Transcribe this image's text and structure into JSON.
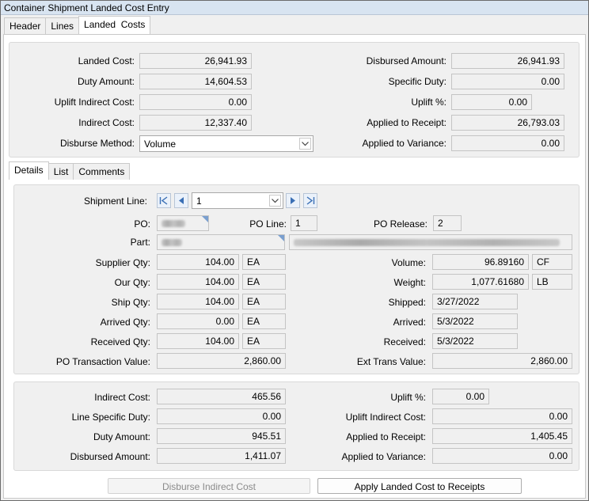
{
  "window": {
    "title": "Container Shipment Landed Cost Entry"
  },
  "main_tabs": [
    "Header",
    "Lines",
    "Landed  Costs"
  ],
  "summary": {
    "landed_cost_label": "Landed Cost:",
    "landed_cost": "26,941.93",
    "duty_amount_label": "Duty Amount:",
    "duty_amount": "14,604.53",
    "uplift_indirect_cost_label": "Uplift Indirect Cost:",
    "uplift_indirect_cost": "0.00",
    "indirect_cost_label": "Indirect Cost:",
    "indirect_cost": "12,337.40",
    "disburse_method_label": "Disburse Method:",
    "disburse_method": "Volume",
    "disbursed_amount_label": "Disbursed Amount:",
    "disbursed_amount": "26,941.93",
    "specific_duty_label": "Specific Duty:",
    "specific_duty": "0.00",
    "uplift_pct_label": "Uplift %:",
    "uplift_pct": "0.00",
    "applied_to_receipt_label": "Applied to Receipt:",
    "applied_to_receipt": "26,793.03",
    "applied_to_variance_label": "Applied to Variance:",
    "applied_to_variance": "0.00"
  },
  "sub_tabs": [
    "Details",
    "List",
    "Comments"
  ],
  "details": {
    "shipment_line_label": "Shipment Line:",
    "shipment_line": "1",
    "po_label": "PO:",
    "po_line_label": "PO Line:",
    "po_line": "1",
    "po_release_label": "PO Release:",
    "po_release": "2",
    "part_label": "Part:",
    "supplier_qty_label": "Supplier Qty:",
    "supplier_qty": "104.00",
    "supplier_qty_uom": "EA",
    "our_qty_label": "Our Qty:",
    "our_qty": "104.00",
    "our_qty_uom": "EA",
    "ship_qty_label": "Ship Qty:",
    "ship_qty": "104.00",
    "ship_qty_uom": "EA",
    "arrived_qty_label": "Arrived Qty:",
    "arrived_qty": "0.00",
    "arrived_qty_uom": "EA",
    "received_qty_label": "Received Qty:",
    "received_qty": "104.00",
    "received_qty_uom": "EA",
    "po_trans_value_label": "PO Transaction Value:",
    "po_trans_value": "2,860.00",
    "volume_label": "Volume:",
    "volume": "96.89160",
    "volume_uom": "CF",
    "weight_label": "Weight:",
    "weight": "1,077.61680",
    "weight_uom": "LB",
    "shipped_label": "Shipped:",
    "shipped": "3/27/2022",
    "arrived_label": "Arrived:",
    "arrived": "5/3/2022",
    "received_label": "Received:",
    "received": "5/3/2022",
    "ext_trans_value_label": "Ext Trans Value:",
    "ext_trans_value": "2,860.00"
  },
  "line_costs": {
    "indirect_cost_label": "Indirect Cost:",
    "indirect_cost": "465.56",
    "line_specific_duty_label": "Line Specific Duty:",
    "line_specific_duty": "0.00",
    "duty_amount_label": "Duty Amount:",
    "duty_amount": "945.51",
    "disbursed_amount_label": "Disbursed Amount:",
    "disbursed_amount": "1,411.07",
    "uplift_pct_label": "Uplift %:",
    "uplift_pct": "0.00",
    "uplift_indirect_cost_label": "Uplift Indirect Cost:",
    "uplift_indirect_cost": "0.00",
    "applied_to_receipt_label": "Applied to Receipt:",
    "applied_to_receipt": "1,405.45",
    "applied_to_variance_label": "Applied to Variance:",
    "applied_to_variance": "0.00"
  },
  "buttons": {
    "disburse_indirect_cost": "Disburse Indirect Cost",
    "apply_landed_cost": "Apply Landed Cost to Receipts"
  },
  "colors": {
    "titlebar": "#d8e4f1",
    "nav_button": "#eaf1fa",
    "nav_arrow": "#3a6fb5"
  }
}
